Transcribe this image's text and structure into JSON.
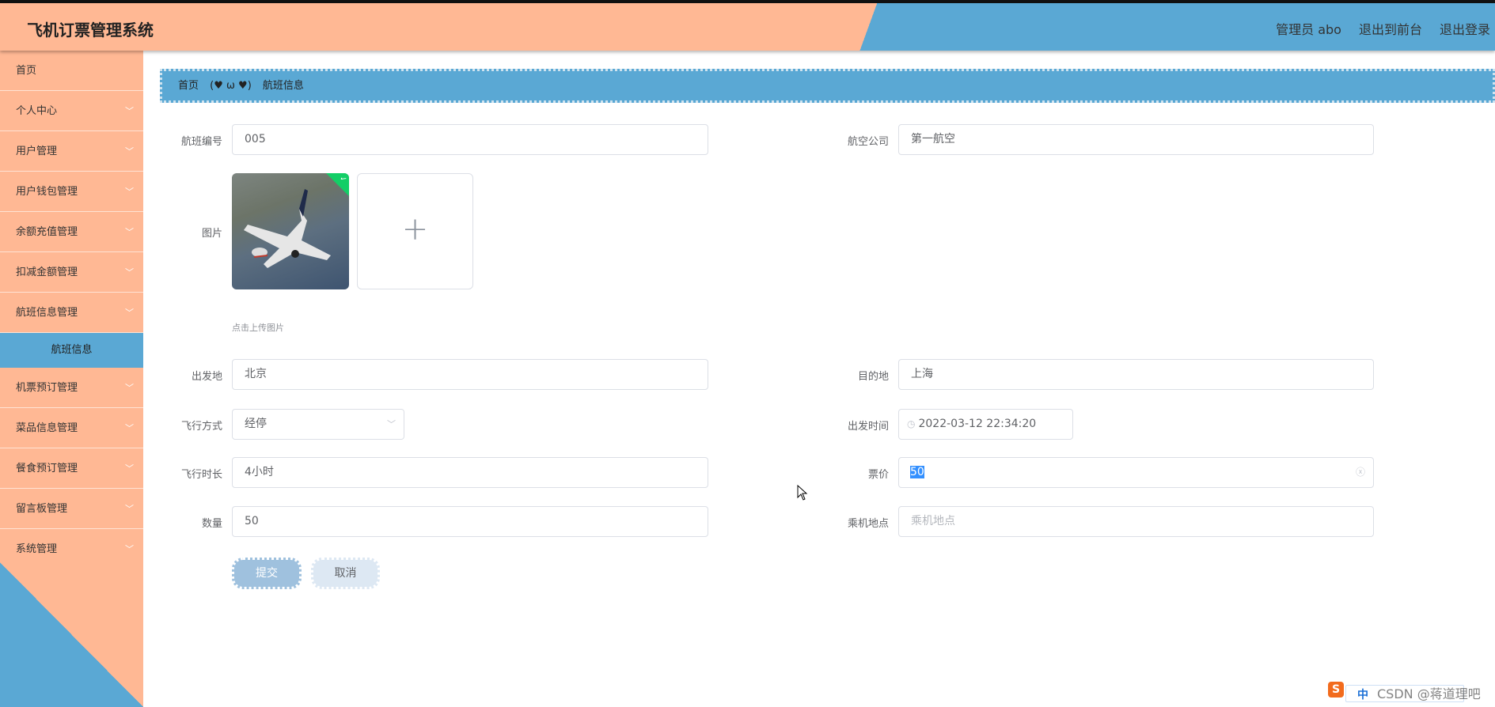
{
  "header": {
    "title": "飞机订票管理系统",
    "user": "管理员 abo",
    "front": "退出到前台",
    "logout": "退出登录"
  },
  "sidebar": {
    "items": [
      "首页",
      "个人中心",
      "用户管理",
      "用户钱包管理",
      "余额充值管理",
      "扣减金额管理",
      "航班信息管理"
    ],
    "active_sub": "航班信息",
    "items2": [
      "机票预订管理",
      "菜品信息管理",
      "餐食预订管理",
      "留言板管理",
      "系统管理"
    ]
  },
  "breadcrumb": {
    "home": "首页",
    "sep": "(♥ ω ♥)",
    "current": "航班信息"
  },
  "form": {
    "flight_no": {
      "label": "航班编号",
      "value": "005"
    },
    "airline": {
      "label": "航空公司",
      "value": "第一航空"
    },
    "image": {
      "label": "图片",
      "hint": "点击上传图片"
    },
    "origin": {
      "label": "出发地",
      "value": "北京"
    },
    "destination": {
      "label": "目的地",
      "value": "上海"
    },
    "mode": {
      "label": "飞行方式",
      "value": "经停"
    },
    "depart_time": {
      "label": "出发时间",
      "value": "2022-03-12 22:34:20"
    },
    "duration": {
      "label": "飞行时长",
      "value": "4小时"
    },
    "price": {
      "label": "票价",
      "value": "50"
    },
    "quantity": {
      "label": "数量",
      "value": "50"
    },
    "boarding": {
      "label": "乘机地点",
      "placeholder": "乘机地点"
    },
    "submit": "提交",
    "cancel": "取消"
  },
  "watermark": "CSDN @蒋道理吧",
  "ime": "中",
  "colors": {
    "peach": "#FFB894",
    "blue": "#5AA8D4",
    "success": "#13ce66"
  }
}
